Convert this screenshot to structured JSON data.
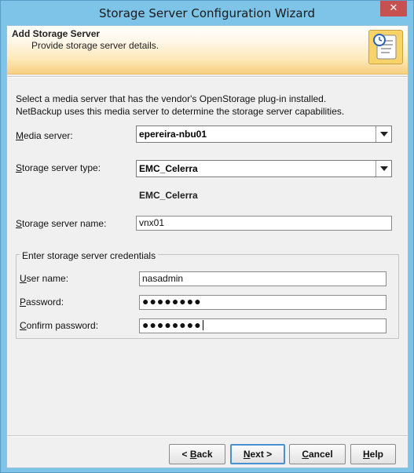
{
  "window": {
    "title": "Storage Server Configuration Wizard",
    "close_label": "✕"
  },
  "banner": {
    "title": "Add Storage Server",
    "subtitle": "Provide storage server details.",
    "icon": "wizard-scroll-icon"
  },
  "intro": {
    "line1": "Select a media server that has the vendor's OpenStorage plug-in installed.",
    "line2": "NetBackup uses this media server to determine the storage server capabilities."
  },
  "media_server": {
    "label_key": "M",
    "label_rest": "edia server:",
    "value": "epereira-nbu01"
  },
  "server_type": {
    "label_key": "S",
    "label_rest": "torage server type:",
    "value": "EMC_Celerra",
    "description": "EMC_Celerra"
  },
  "server_name": {
    "label_key": "S",
    "label_rest": "torage server name:",
    "value": "vnx01"
  },
  "credentials": {
    "group_title": "Enter storage server credentials",
    "user": {
      "label_key": "U",
      "label_rest": "ser name:",
      "value": "nasadmin"
    },
    "password": {
      "label_key": "P",
      "label_rest": "assword:",
      "value": "●●●●●●●●"
    },
    "confirm": {
      "label_key": "C",
      "label_rest": "onfirm password:",
      "value": "●●●●●●●●"
    }
  },
  "buttons": {
    "back": {
      "prefix": "< ",
      "key": "B",
      "rest": "ack"
    },
    "next": {
      "key": "N",
      "rest": "ext >"
    },
    "cancel": {
      "key": "C",
      "rest": "ancel"
    },
    "help": {
      "key": "H",
      "rest": "elp"
    }
  },
  "colors": {
    "titlebar": "#7ec4e8",
    "close": "#c75050",
    "default_button_border": "#4a8fd0"
  }
}
